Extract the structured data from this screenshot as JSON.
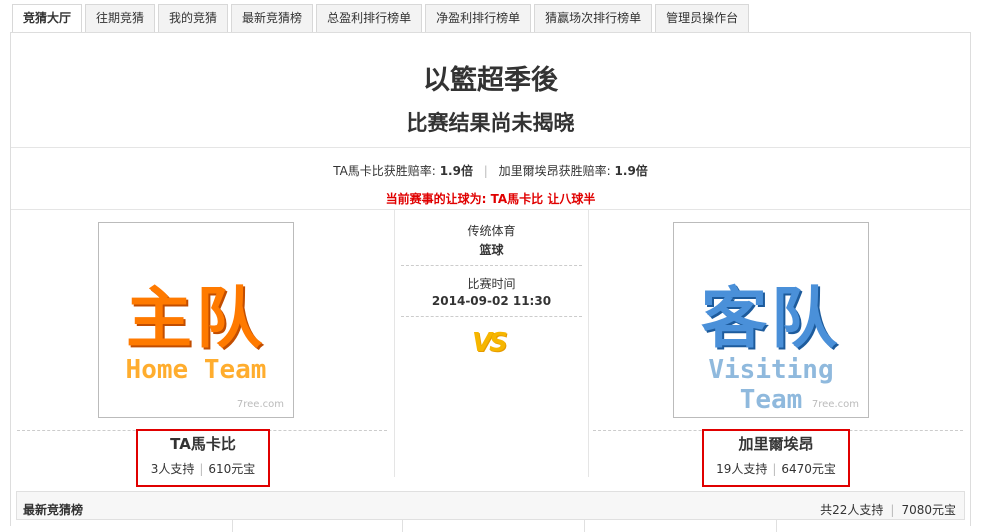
{
  "tabs": [
    {
      "label": "竞猜大厅",
      "active": true
    },
    {
      "label": "往期竞猜",
      "active": false
    },
    {
      "label": "我的竞猜",
      "active": false
    },
    {
      "label": "最新竞猜榜",
      "active": false
    },
    {
      "label": "总盈利排行榜单",
      "active": false
    },
    {
      "label": "净盈利排行榜单",
      "active": false
    },
    {
      "label": "猜赢场次排行榜单",
      "active": false
    },
    {
      "label": "管理员操作台",
      "active": false
    }
  ],
  "match": {
    "title": "以籃超季後",
    "status": "比赛结果尚未揭晓",
    "odds": {
      "home_label": "TA馬卡比获胜赔率:",
      "home_value": "1.9倍",
      "away_label": "加里爾埃昂获胜赔率:",
      "away_value": "1.9倍"
    },
    "handicap_text": "当前赛事的让球为: TA馬卡比 让八球半",
    "category_label": "传统体育",
    "category_value": "篮球",
    "time_label": "比赛时间",
    "time_value": "2014-09-02 11:30",
    "vs_text": "VS"
  },
  "home": {
    "image_cn": "主队",
    "image_en": "Home Team",
    "watermark": "7ree.com",
    "name": "TA馬卡比",
    "supporters": "3人支持",
    "amount": "610元宝"
  },
  "away": {
    "image_cn": "客队",
    "image_en": "Visiting Team",
    "watermark": "7ree.com",
    "name": "加里爾埃昂",
    "supporters": "19人支持",
    "amount": "6470元宝"
  },
  "board": {
    "title": "最新竞猜榜",
    "total_supporters": "共22人支持",
    "total_amount": "7080元宝"
  },
  "colors": {
    "highlight_red": "#e00000",
    "home_orange": "#ff7a00",
    "away_blue": "#4a90d9",
    "vs_gold": "#f6b600"
  }
}
